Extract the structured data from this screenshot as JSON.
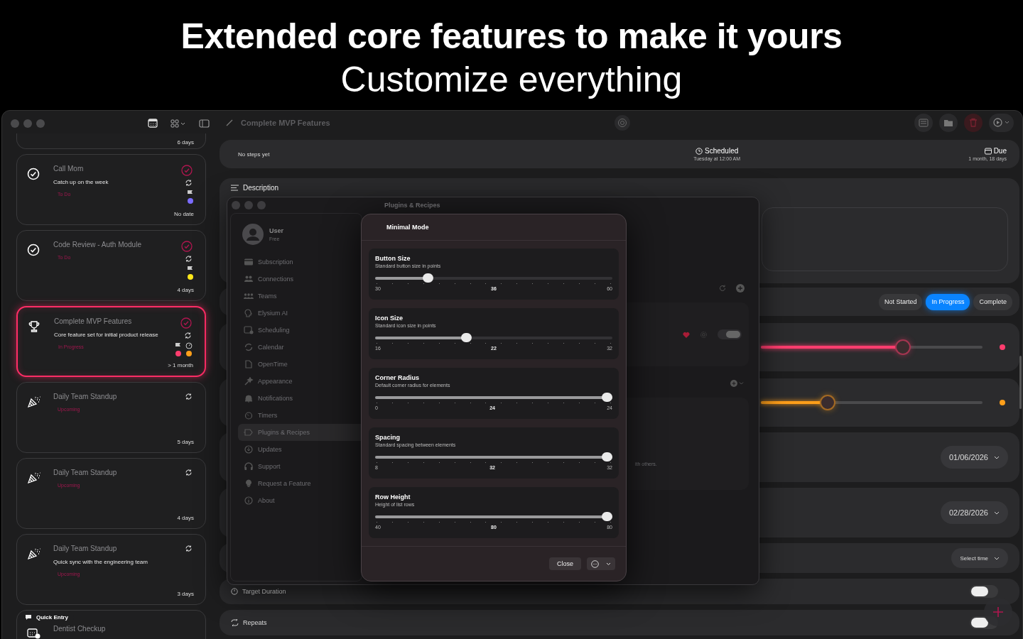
{
  "headline": {
    "title": "Extended core features to make it yours",
    "subtitle": "Customize everything"
  },
  "task_list": [
    {
      "kind": "cut",
      "due": "6 days",
      "selected": false
    },
    {
      "kind": "check",
      "title": "Call Mom",
      "note": "Catch up on the week",
      "status": "To Do",
      "due": "No date",
      "check_ring": true,
      "markers": [
        {
          "kind": "flag",
          "color": "#7b6cff"
        }
      ],
      "selected": false
    },
    {
      "kind": "check",
      "title": "Code Review - Auth Module",
      "status": "To Do",
      "due": "4 days",
      "check_ring": true,
      "markers": [
        {
          "kind": "flag",
          "color": "#ffe81a"
        }
      ],
      "selected": false
    },
    {
      "kind": "trophy",
      "title": "Complete MVP Features",
      "note": "Core feature set for initial product release",
      "status": "In Progress",
      "due": "> 1 month",
      "check_ring": true,
      "markers": [
        {
          "kind": "flag",
          "color": "#ff3d6e"
        },
        {
          "kind": "gauge",
          "color": "#ff9f1a"
        }
      ],
      "selected": true
    },
    {
      "kind": "party",
      "title": "Daily Team Standup",
      "status": "Upcoming",
      "due": "5 days",
      "check_ring": false,
      "selected": false
    },
    {
      "kind": "party",
      "title": "Daily Team Standup",
      "status": "Upcoming",
      "due": "4 days",
      "check_ring": false,
      "selected": false
    },
    {
      "kind": "party",
      "title": "Daily Team Standup",
      "note": "Quick sync with the engineering team",
      "status": "Upcoming",
      "due": "3 days",
      "check_ring": false,
      "selected": false
    },
    {
      "kind": "calendar",
      "title": "Dentist Checkup",
      "check_ring": false,
      "selected": false
    }
  ],
  "quick_entry": {
    "label": "Quick Entry"
  },
  "editor": {
    "title": "Complete MVP Features",
    "steps": "No steps yet",
    "scheduled": {
      "label": "Scheduled",
      "value": "Tuesday at 12:00 AM"
    },
    "due": {
      "label": "Due",
      "value": "1 month, 18 days"
    },
    "description_label": "Description",
    "status_options": [
      {
        "label": "Not Started",
        "selected": false
      },
      {
        "label": "In Progress",
        "selected": true
      },
      {
        "label": "Complete",
        "selected": false
      }
    ],
    "sliders": [
      {
        "level": 0.64,
        "color": "#ff3d6e"
      },
      {
        "level": 0.3,
        "color": "#ff9f1a"
      }
    ],
    "dates": [
      "01/06/2026",
      "02/28/2026"
    ],
    "time_label": "Select time",
    "toggles": [
      {
        "label": "Target Duration",
        "kind": "target",
        "on": false
      },
      {
        "label": "Repeats",
        "kind": "repeat",
        "on": false
      }
    ]
  },
  "settings_window": {
    "title": "Plugins & Recipes",
    "user": {
      "name": "User",
      "plan": "Free"
    },
    "nav": [
      {
        "label": "Subscription",
        "kind": "card",
        "selected": false
      },
      {
        "label": "Connections",
        "kind": "people",
        "selected": false
      },
      {
        "label": "Teams",
        "kind": "team",
        "selected": false
      },
      {
        "label": "Elysium AI",
        "kind": "head",
        "selected": false
      },
      {
        "label": "Scheduling",
        "kind": "schedule",
        "selected": false
      },
      {
        "label": "Calendar",
        "kind": "sync",
        "selected": false
      },
      {
        "label": "OpenTime",
        "kind": "doc",
        "selected": false
      },
      {
        "label": "Appearance",
        "kind": "wand",
        "selected": false
      },
      {
        "label": "Notifications",
        "kind": "bell",
        "selected": false
      },
      {
        "label": "Timers",
        "kind": "timer",
        "selected": false
      },
      {
        "label": "Plugins & Recipes",
        "kind": "plug",
        "selected": true
      },
      {
        "label": "Updates",
        "kind": "download",
        "selected": false
      },
      {
        "label": "Support",
        "kind": "headphones",
        "selected": false
      },
      {
        "label": "Request a Feature",
        "kind": "bulb",
        "selected": false
      },
      {
        "label": "About",
        "kind": "info",
        "selected": false
      }
    ],
    "plugin_toggle_on": true,
    "hint_fragment": "ith others."
  },
  "modal": {
    "title": "Minimal Mode",
    "close": "Close",
    "settings": [
      {
        "label": "Button Size",
        "description": "Standard button size in points",
        "min": "30",
        "value": "36",
        "max": "60",
        "level": 0.21
      },
      {
        "label": "Icon Size",
        "description": "Standard icon size in points",
        "min": "16",
        "value": "22",
        "max": "32",
        "level": 0.38
      },
      {
        "label": "Corner Radius",
        "description": "Default corner radius for elements",
        "min": "0",
        "value": "24",
        "max": "24",
        "level": 1
      },
      {
        "label": "Spacing",
        "description": "Standard spacing between elements",
        "min": "8",
        "value": "32",
        "max": "32",
        "level": 1
      },
      {
        "label": "Row Height",
        "description": "Height of list rows",
        "min": "40",
        "value": "80",
        "max": "80",
        "level": 1
      }
    ]
  }
}
